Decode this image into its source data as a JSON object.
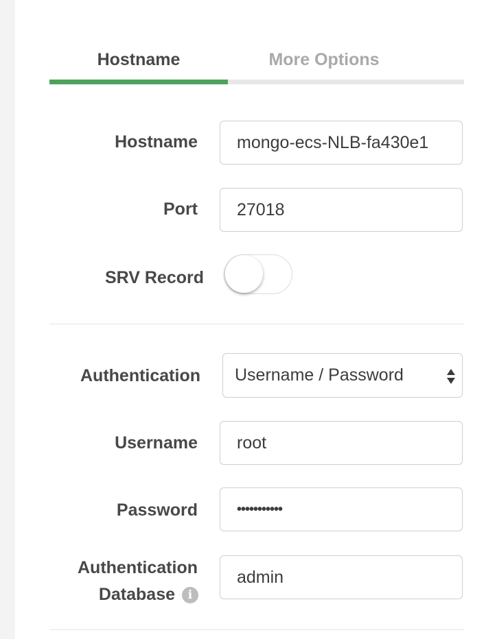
{
  "tabs": {
    "hostname": "Hostname",
    "more_options": "More Options"
  },
  "form": {
    "hostname": {
      "label": "Hostname",
      "value": "mongo-ecs-NLB-fa430e1"
    },
    "port": {
      "label": "Port",
      "value": "27018"
    },
    "srv_record": {
      "label": "SRV Record",
      "enabled": false
    },
    "authentication": {
      "label": "Authentication",
      "selected": "Username / Password"
    },
    "username": {
      "label": "Username",
      "value": "root"
    },
    "password": {
      "label": "Password",
      "value": "•••••••••••"
    },
    "auth_database": {
      "label_line1": "Authentication",
      "label_line2": "Database",
      "value": "admin"
    }
  },
  "icons": {
    "info": "info-icon",
    "select_arrows": "up-down-arrows-icon"
  },
  "colors": {
    "active_tab_accent": "#4ea35c",
    "inactive_tab_text": "#a9a9a9",
    "label_text": "#494747"
  }
}
